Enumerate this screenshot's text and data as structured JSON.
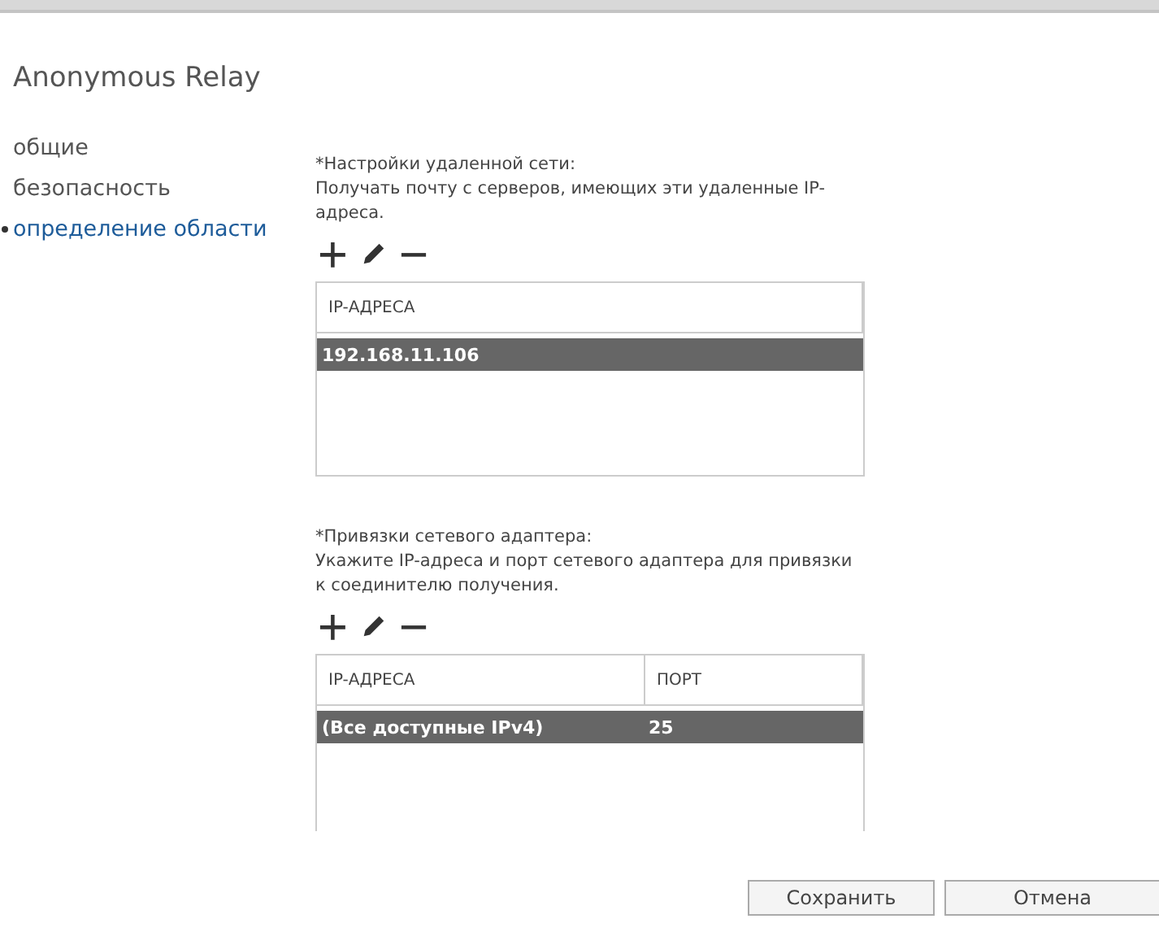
{
  "window": {
    "title": "Anonymous Relay"
  },
  "sidebar": {
    "items": [
      {
        "label": "общие",
        "selected": false
      },
      {
        "label": "безопасность",
        "selected": false
      },
      {
        "label": "определение области",
        "selected": true
      }
    ]
  },
  "sections": [
    {
      "label": "*Настройки удаленной сети:",
      "description": "Получать почту с серверов, имеющих эти удаленные IP-адреса.",
      "table": {
        "columns": [
          "IP-АДРЕСА"
        ],
        "rows": [
          {
            "cells": [
              "192.168.11.106"
            ],
            "selected": true
          }
        ]
      }
    },
    {
      "label": "*Привязки сетевого адаптера:",
      "description": "Укажите IP-адреса и порт сетевого адаптера для привязки к соединителю получения.",
      "table": {
        "columns": [
          "IP-АДРЕСА",
          "ПОРТ"
        ],
        "rows": [
          {
            "cells": [
              "(Все доступные IPv4)",
              "25"
            ],
            "selected": true
          }
        ]
      }
    }
  ],
  "buttons": [
    "Сохранить",
    "Отмена"
  ]
}
